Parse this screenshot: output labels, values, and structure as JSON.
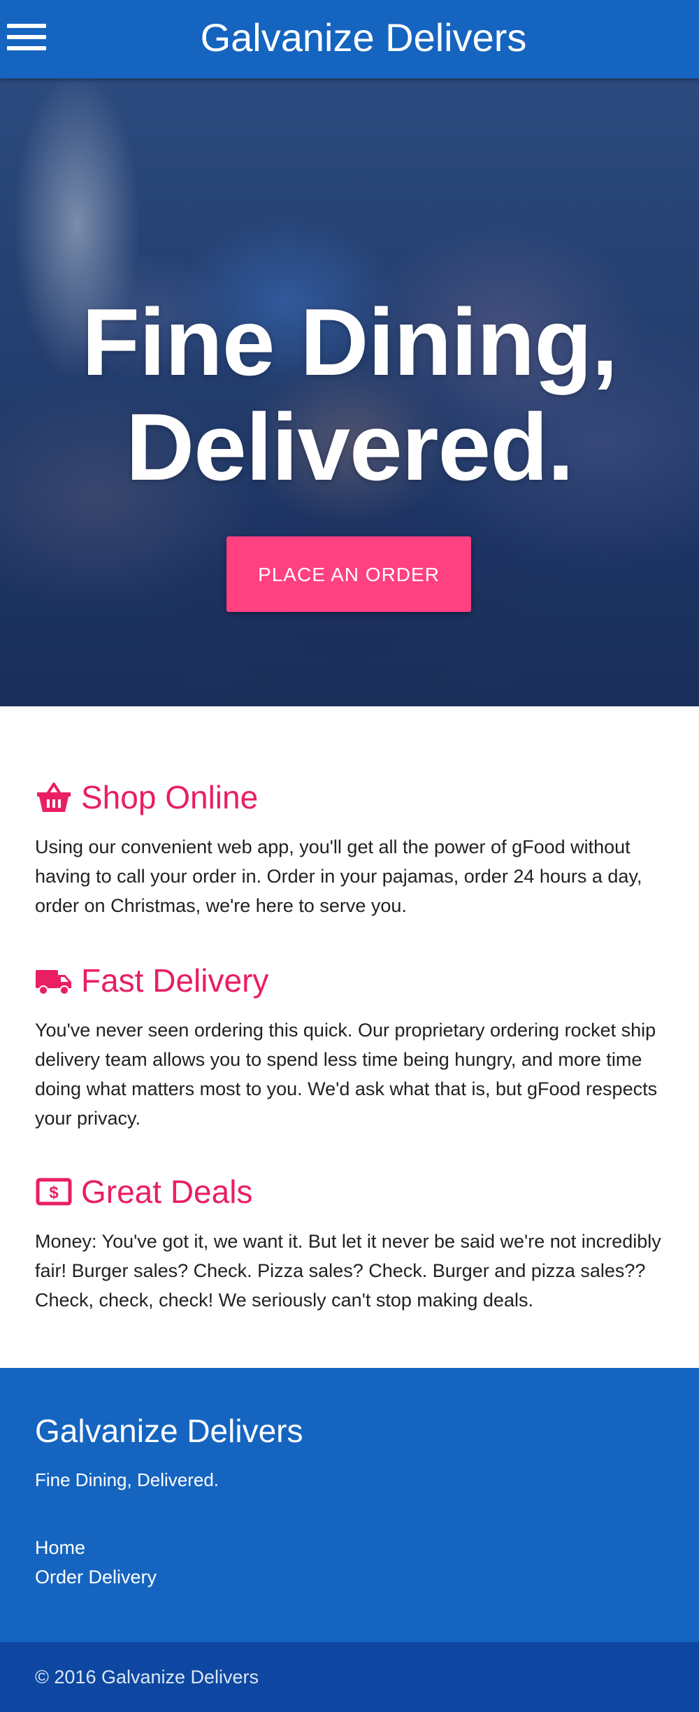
{
  "navbar": {
    "brand": "Galvanize Delivers",
    "menu_icon": "hamburger-menu-icon",
    "color": "#1565c0"
  },
  "hero": {
    "title_line1": "Fine Dining,",
    "title_line2": "Delivered.",
    "cta_label": "PLACE AN ORDER",
    "cta_color": "#ff4081"
  },
  "features": [
    {
      "icon": "shopping-basket-icon",
      "title": "Shop Online",
      "text": "Using our convenient web app, you'll get all the power of gFood without having to call your order in. Order in your pajamas, order 24 hours a day, order on Christmas, we're here to serve you."
    },
    {
      "icon": "truck-icon",
      "title": "Fast Delivery",
      "text": "You've never seen ordering this quick. Our proprietary ordering rocket ship delivery team allows you to spend less time being hungry, and more time doing what matters most to you. We'd ask what that is, but gFood respects your privacy."
    },
    {
      "icon": "money-bill-icon",
      "title": "Great Deals",
      "text": "Money: You've got it, we want it. But let it never be said we're not incredibly fair! Burger sales? Check. Pizza sales? Check. Burger and pizza sales?? Check, check, check! We seriously can't stop making deals."
    }
  ],
  "accent_color": "#e91e63",
  "footer": {
    "title": "Galvanize Delivers",
    "tagline": "Fine Dining, Delivered.",
    "links": [
      "Home",
      "Order Delivery"
    ],
    "copyright": "© 2016 Galvanize Delivers"
  }
}
